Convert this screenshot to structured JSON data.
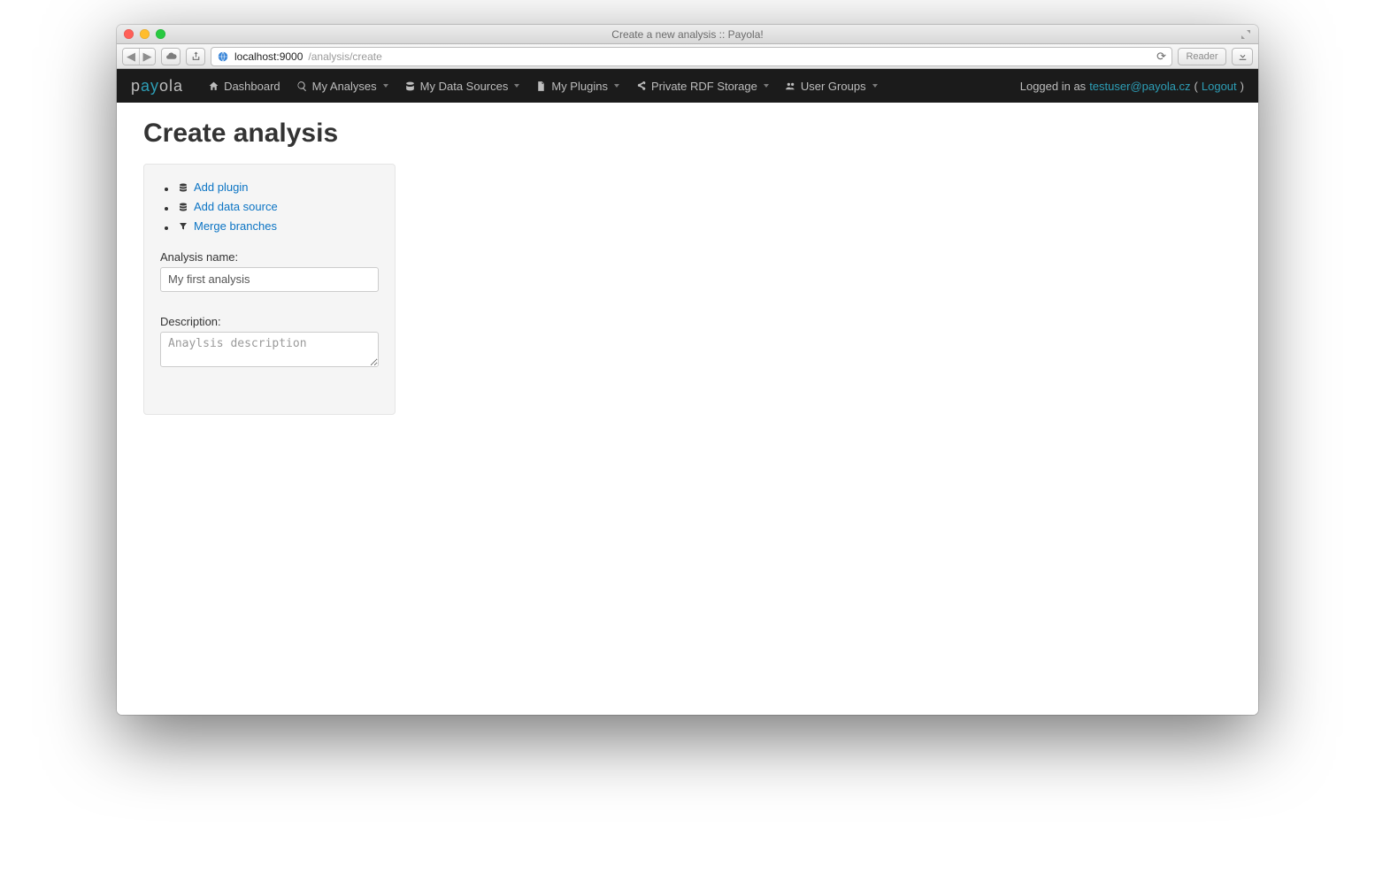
{
  "window": {
    "title": "Create a new analysis :: Payola!"
  },
  "browser": {
    "url_host": "localhost:9000",
    "url_path": "/analysis/create",
    "reader_label": "Reader"
  },
  "brand": {
    "pre": "p",
    "accent": "ay",
    "post": "ola"
  },
  "nav": {
    "items": [
      {
        "label": "Dashboard",
        "icon": "home-icon",
        "dropdown": false
      },
      {
        "label": "My Analyses",
        "icon": "search-icon",
        "dropdown": true
      },
      {
        "label": "My Data Sources",
        "icon": "database-icon",
        "dropdown": true
      },
      {
        "label": "My Plugins",
        "icon": "file-icon",
        "dropdown": true
      },
      {
        "label": "Private RDF Storage",
        "icon": "share-icon",
        "dropdown": true
      },
      {
        "label": "User Groups",
        "icon": "users-icon",
        "dropdown": true
      }
    ],
    "logged_in_prefix": "Logged in as ",
    "user_email": "testuser@payola.cz",
    "logout_label": "Logout"
  },
  "page": {
    "heading": "Create analysis",
    "actions": [
      {
        "label": "Add plugin",
        "icon": "database-icon"
      },
      {
        "label": "Add data source",
        "icon": "database-icon"
      },
      {
        "label": "Merge branches",
        "icon": "filter-icon"
      }
    ],
    "name_label": "Analysis name:",
    "name_value": "My first analysis",
    "desc_label": "Description:",
    "desc_placeholder": "Anaylsis description"
  }
}
